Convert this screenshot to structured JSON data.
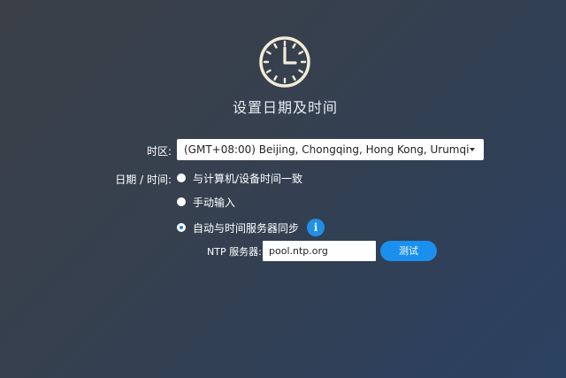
{
  "header": {
    "clock_icon": "clock-icon",
    "title": "设置日期及时间"
  },
  "timezone": {
    "label": "时区:",
    "selected": "(GMT+08:00) Beijing, Chongqing, Hong Kong, Urumqi"
  },
  "datetime": {
    "label": "日期 / 时间:",
    "options": [
      {
        "label": "与计算机/设备时间一致",
        "checked": false
      },
      {
        "label": "手动输入",
        "checked": false
      },
      {
        "label": "自动与时间服务器同步",
        "checked": true
      }
    ],
    "info_icon": "info-icon"
  },
  "ntp": {
    "label": "NTP 服务器:",
    "value": "pool.ntp.org",
    "test_label": "测试"
  },
  "colors": {
    "accent": "#1a8fee",
    "background_start": "#3b4048",
    "background_end": "#2c4262"
  }
}
